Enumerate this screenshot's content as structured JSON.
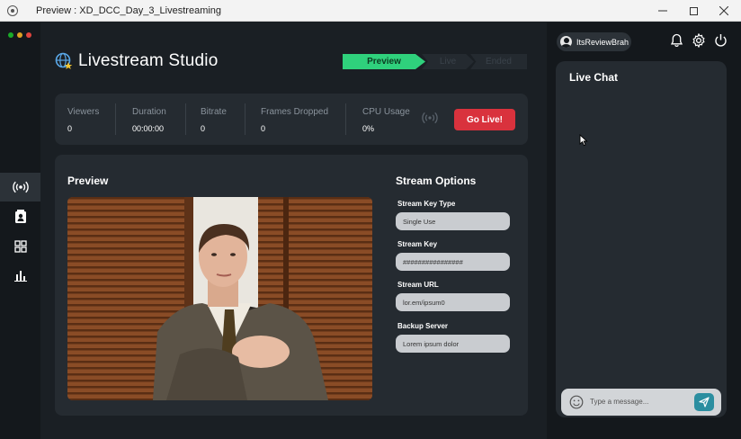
{
  "window": {
    "title": "Preview : XD_DCC_Day_3_Livestreaming"
  },
  "colors": {
    "accent_green": "#2fd17c",
    "go_live_red": "#d9323d",
    "card_bg": "#252b31",
    "app_bg": "#1a1f24",
    "send_teal": "#2b8ea0",
    "dot_red": "#e0443e",
    "dot_yellow": "#dea123",
    "dot_green": "#1aab29"
  },
  "app": {
    "title": "Livestream Studio",
    "logo_icon": "globe-star-icon"
  },
  "steps": [
    {
      "label": "Preview",
      "state": "active"
    },
    {
      "label": "Live",
      "state": "inactive"
    },
    {
      "label": "Ended",
      "state": "inactive"
    }
  ],
  "sidebar": {
    "items": [
      {
        "icon": "broadcast-icon",
        "active": true
      },
      {
        "icon": "contact-book-icon",
        "active": false
      },
      {
        "icon": "grid-icon",
        "active": false
      },
      {
        "icon": "bar-chart-icon",
        "active": false
      }
    ]
  },
  "stats": {
    "items": [
      {
        "label": "Viewers",
        "value": "0"
      },
      {
        "label": "Duration",
        "value": "00:00:00"
      },
      {
        "label": "Bitrate",
        "value": "0"
      },
      {
        "label": "Frames Dropped",
        "value": "0"
      },
      {
        "label": "CPU Usage",
        "value": "0%"
      }
    ],
    "go_live_label": "Go Live!"
  },
  "preview": {
    "title": "Preview"
  },
  "options": {
    "title": "Stream Options",
    "fields": [
      {
        "label": "Stream Key Type",
        "value": "Single Use"
      },
      {
        "label": "Stream Key",
        "value": "################"
      },
      {
        "label": "Stream URL",
        "value": "lor.em/ipsum0"
      },
      {
        "label": "Backup Server",
        "value": "Lorem ipsum dolor"
      }
    ]
  },
  "user": {
    "name": "ItsReviewBrah"
  },
  "chat": {
    "title": "Live Chat",
    "placeholder": "Type a message..."
  }
}
